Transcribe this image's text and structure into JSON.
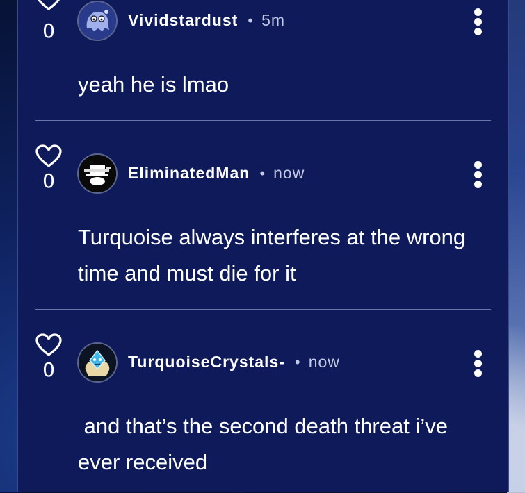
{
  "comments": [
    {
      "username": "Vividstardust",
      "time": "5m",
      "separator": "•",
      "likes": "0",
      "text": "yeah he is lmao",
      "avatar": "ghost-icon"
    },
    {
      "username": "EliminatedMan",
      "time": "now",
      "separator": "•",
      "likes": "0",
      "text": "Turquoise always interferes at the wrong time and must die for it",
      "avatar": "hat-gun-icon"
    },
    {
      "username": "TurquoiseCrystals-",
      "time": "now",
      "separator": "•",
      "likes": "0",
      "text": " and that’s the second death threat i’ve ever received",
      "avatar": "crystal-icon"
    }
  ],
  "colors": {
    "panel": "#0e1a5a",
    "divider": "#6a76a6",
    "text": "#ffffff",
    "muted": "#c5cbe6"
  }
}
